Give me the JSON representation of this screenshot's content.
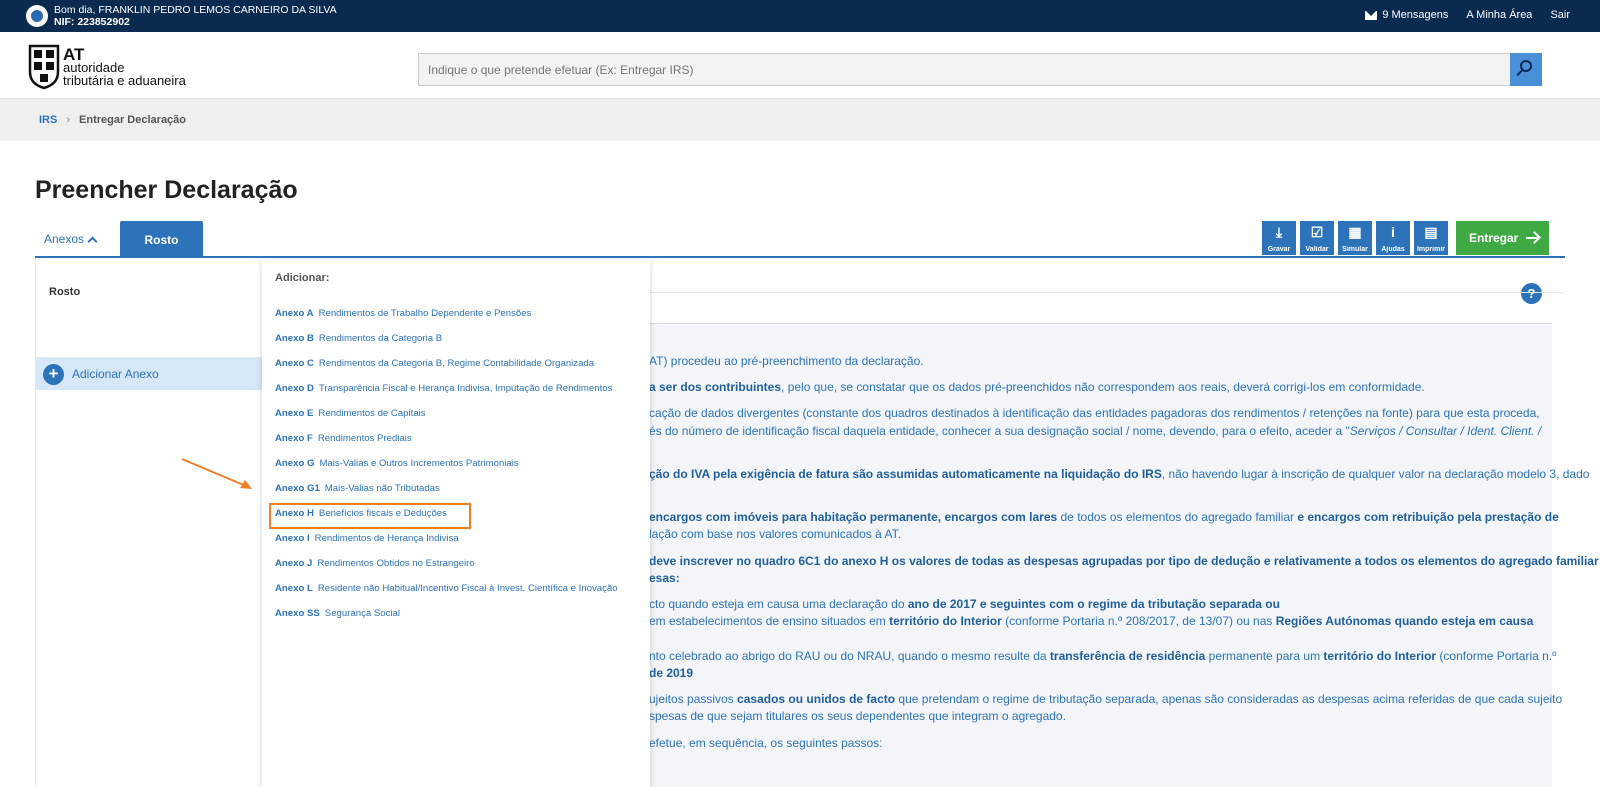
{
  "topbar": {
    "greeting": "Bom dia, FRANKLIN PEDRO LEMOS CARNEIRO DA SILVA",
    "nif": "NIF: 223852902",
    "messages": "9 Mensagens",
    "my_area": "A Minha Área",
    "logout": "Sair"
  },
  "header": {
    "logo_line1": "AT",
    "logo_line2": "autoridade",
    "logo_line3": "tributária e aduaneira",
    "search_placeholder": "Indique o que pretende efetuar (Ex: Entregar IRS)"
  },
  "breadcrumb": {
    "home": "IRS",
    "current": "Entregar Declaração"
  },
  "page_title": "Preencher Declaração",
  "tabs": {
    "anexos": "Anexos",
    "rosto": "Rosto"
  },
  "toolbar": {
    "gravar": "Gravar",
    "validar": "Validar",
    "simular": "Simular",
    "ajudas": "Ajudas",
    "imprimir": "Imprimir",
    "entregar": "Entregar"
  },
  "left_panel": {
    "rosto": "Rosto",
    "add_annex": "Adicionar Anexo"
  },
  "dropdown": {
    "header": "Adicionar:",
    "items": [
      {
        "code": "Anexo A",
        "desc": "Rendimentos de Trabalho Dependente e Pensões"
      },
      {
        "code": "Anexo B",
        "desc": "Rendimentos da Categoria B"
      },
      {
        "code": "Anexo C",
        "desc": "Rendimentos da Categoria B, Regime Contabilidade Organizada"
      },
      {
        "code": "Anexo D",
        "desc": "Transparência Fiscal e Herança Indivisa, Imputação de Rendimentos"
      },
      {
        "code": "Anexo E",
        "desc": "Rendimentos de Capitais"
      },
      {
        "code": "Anexo F",
        "desc": "Rendimentos Prediais"
      },
      {
        "code": "Anexo G",
        "desc": "Mais-Valias e Outros Incrementos Patrimoniais"
      },
      {
        "code": "Anexo G1",
        "desc": "Mais-Valias não Tributadas"
      },
      {
        "code": "Anexo H",
        "desc": "Benefícios fiscais e Deduções"
      },
      {
        "code": "Anexo I",
        "desc": "Rendimentos de Herança Indivisa"
      },
      {
        "code": "Anexo J",
        "desc": "Rendimentos Obtidos no Estrangeiro"
      },
      {
        "code": "Anexo L",
        "desc": "Residente não Habitual/Incentivo Fiscal à Invest. Científica e Inovação"
      },
      {
        "code": "Anexo SS",
        "desc": "Segurança Social"
      }
    ]
  },
  "main": {
    "help": "?",
    "lines": {
      "l1": "AT) procedeu ao pré-preenchimento da declaração.",
      "l2a": "a ser dos contribuintes",
      "l2b": ", pelo que, se constatar que os dados pré-preenchidos não correspondem aos reais, deverá corrigi-los em conformidade.",
      "l3": "cação de dados divergentes (constante dos quadros destinados à identificação das entidades pagadoras dos rendimentos / retenções na fonte) para que esta proceda,",
      "l4a": "és do número de identificação fiscal daquela entidade, conhecer a sua designação social / nome, devendo, para o efeito, aceder a \"",
      "l4b": "Serviços / Consultar / Ident. Client. /",
      "l5a": "ção do IVA pela exigência de fatura são assumidas automaticamente na liquidação do IRS",
      "l5b": ", não havendo lugar à inscrição de qualquer valor na declaração modelo 3, dado",
      "l6a": "encargos com imóveis para habitação permanente, encargos com lares",
      "l6b": " de todos os elementos do agregado familiar ",
      "l6c": "e encargos com retribuição pela prestação de",
      "l7": "lação com base nos valores comunicados à AT.",
      "l8": "deve inscrever no quadro 6C1 do anexo H os valores de todas as despesas agrupadas por tipo de dedução e relativamente a todos os elementos do agregado familiar",
      "l9": "esas:",
      "l10a": "cto quando esteja em causa uma declaração do ",
      "l10b": "ano de 2017 e seguintes com o regime da tributação separada ou",
      "l11a": "em estabelecimentos de ensino situados em ",
      "l11b": "território do Interior",
      "l11c": " (conforme Portaria n.º 208/2017, de 13/07) ou nas ",
      "l11d": "Regiões Autónomas quando esteja em causa",
      "l12a": "nto celebrado ao abrigo do RAU ou do NRAU, quando o mesmo resulte da ",
      "l12b": "transferência de residência",
      "l12c": " permanente para um ",
      "l12d": "território do Interior",
      "l12e": " (conforme Portaria n.º",
      "l13": "de 2019",
      "l14a": "ujeitos passivos ",
      "l14b": "casados ou unidos de facto",
      "l14c": " que pretendam o regime de tributação separada, apenas são consideradas as despesas acima referidas de que cada sujeito",
      "l15": "spesas de que sejam titulares os seus dependentes que integram o agregado.",
      "l16": "efetue, em sequência, os seguintes passos:"
    }
  },
  "colors": {
    "navy": "#0b2a4f",
    "blue": "#2d73b9",
    "green": "#3fa943",
    "highlight": "#f07d28"
  }
}
